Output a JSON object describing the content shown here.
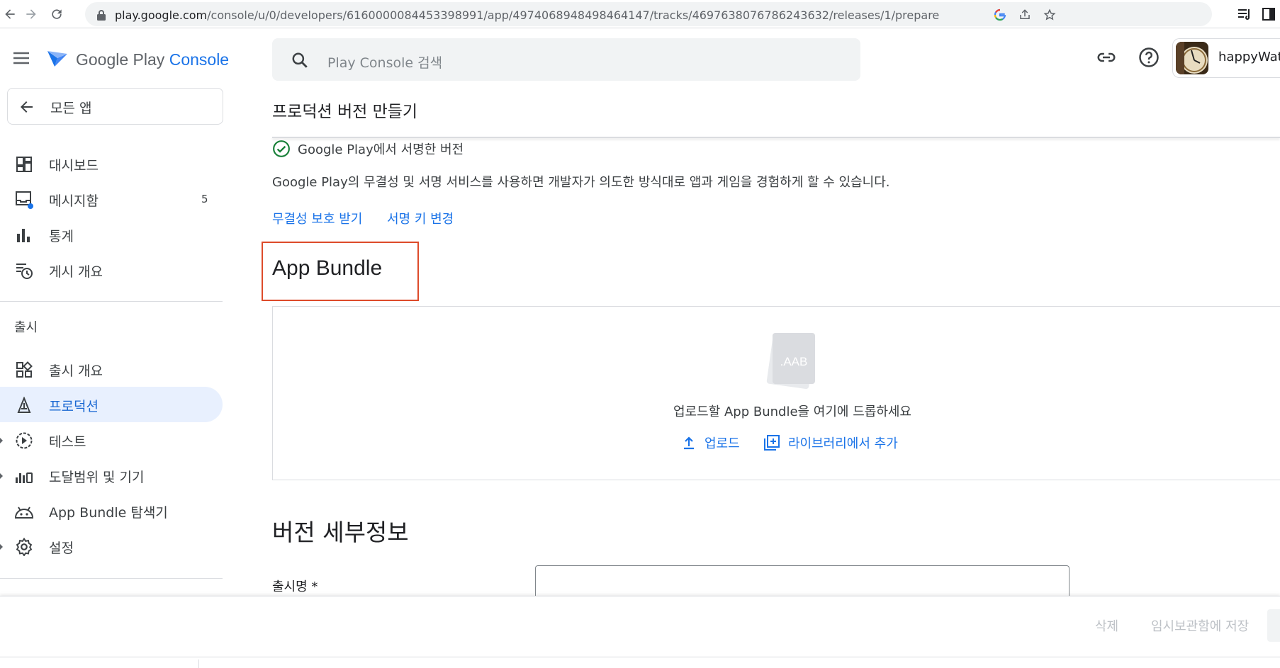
{
  "browser": {
    "url_host": "play.google.com",
    "url_path": "/console/u/0/developers/6160000084453398991/app/4974068948498464147/tracks/4697638076786243632/releases/1/prepare"
  },
  "header": {
    "logo_prefix": "Google Play ",
    "logo_suffix": "Console",
    "search_placeholder": "Play Console 검색",
    "account_name": "happyWatc"
  },
  "sidebar": {
    "all_apps": "모든 앱",
    "items": [
      {
        "label": "대시보드",
        "icon": "dashboard-icon"
      },
      {
        "label": "메시지함",
        "icon": "inbox-icon",
        "count": "5"
      },
      {
        "label": "통계",
        "icon": "bar-chart-icon"
      },
      {
        "label": "게시 개요",
        "icon": "publishing-overview-icon"
      }
    ],
    "section_release": "출시",
    "release_items": [
      {
        "label": "출시 개요",
        "icon": "release-overview-icon"
      },
      {
        "label": "프로덕션",
        "icon": "production-icon",
        "active": true
      },
      {
        "label": "테스트",
        "icon": "testing-icon"
      },
      {
        "label": "도달범위 및 기기",
        "icon": "reach-devices-icon"
      },
      {
        "label": "App Bundle 탐색기",
        "icon": "android-icon"
      },
      {
        "label": "설정",
        "icon": "settings-icon"
      }
    ]
  },
  "main": {
    "page_title": "프로덕션 버전 만들기",
    "signed_by": "Google Play에서 서명한 버전",
    "description": "Google Play의 무결성 및 서명 서비스를 사용하면 개발자가 의도한 방식대로 앱과 게임을 경험하게 할 수 있습니다.",
    "link_integrity": "무결성 보호 받기",
    "link_signing_key": "서명 키 변경",
    "bundle_heading": "App Bundle",
    "aab_label": ".AAB",
    "drop_text": "업로드할 App Bundle을 여기에 드롭하세요",
    "upload_label": "업로드",
    "library_label": "라이브러리에서 추가",
    "details_heading": "버전 세부정보",
    "release_name_label": "출시명",
    "required_mark": "*"
  },
  "footer": {
    "delete_label": "삭제",
    "save_draft_label": "임시보관함에 저장"
  },
  "colors": {
    "accent": "#1a73e8",
    "active_bg": "#e8f0fe",
    "highlight_border": "#dd4b2a",
    "success": "#188038"
  }
}
